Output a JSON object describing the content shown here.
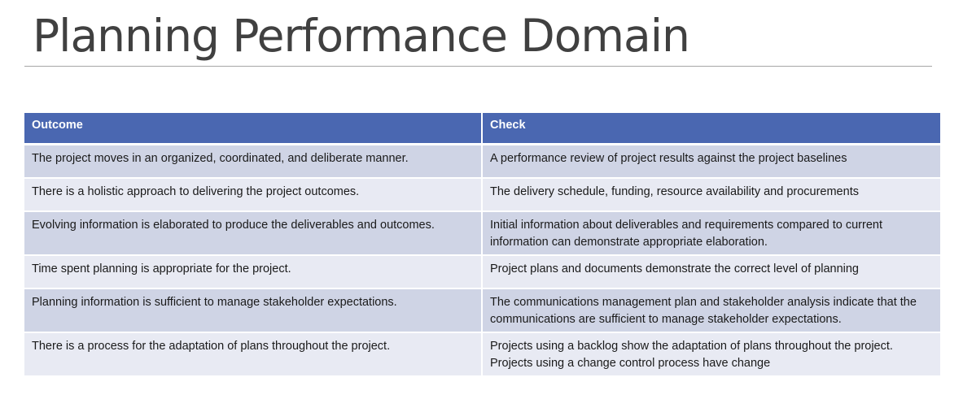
{
  "slide": {
    "title": "Planning Performance Domain"
  },
  "table": {
    "headers": {
      "outcome": "Outcome",
      "check": "Check"
    },
    "rows": [
      {
        "outcome": "The project moves in an organized, coordinated, and deliberate manner.",
        "check": "A performance review of project results against the project baselines"
      },
      {
        "outcome": "There is a holistic approach to delivering the project outcomes.",
        "check": "The delivery schedule, funding, resource availability and procurements"
      },
      {
        "outcome": "Evolving information is elaborated to produce the deliverables and outcomes.",
        "check": "Initial information about deliverables and requirements compared to current information can demonstrate appropriate elaboration."
      },
      {
        "outcome": "Time spent planning is appropriate for the project.",
        "check": "Project plans and documents demonstrate the correct level of planning"
      },
      {
        "outcome": "Planning information is sufficient to manage stakeholder expectations.",
        "check": "The communications management plan and stakeholder analysis indicate that the communications are sufficient to manage stakeholder expectations."
      },
      {
        "outcome": "There is a process for the adaptation of plans throughout the project.",
        "check": "Projects using a backlog show the adaptation of plans throughout the project. Projects using a change control process have change"
      }
    ]
  },
  "colors": {
    "header_bg": "#4a67b1",
    "row_odd": "#cfd4e5",
    "row_even": "#e8eaf3",
    "title_text": "#404040"
  }
}
